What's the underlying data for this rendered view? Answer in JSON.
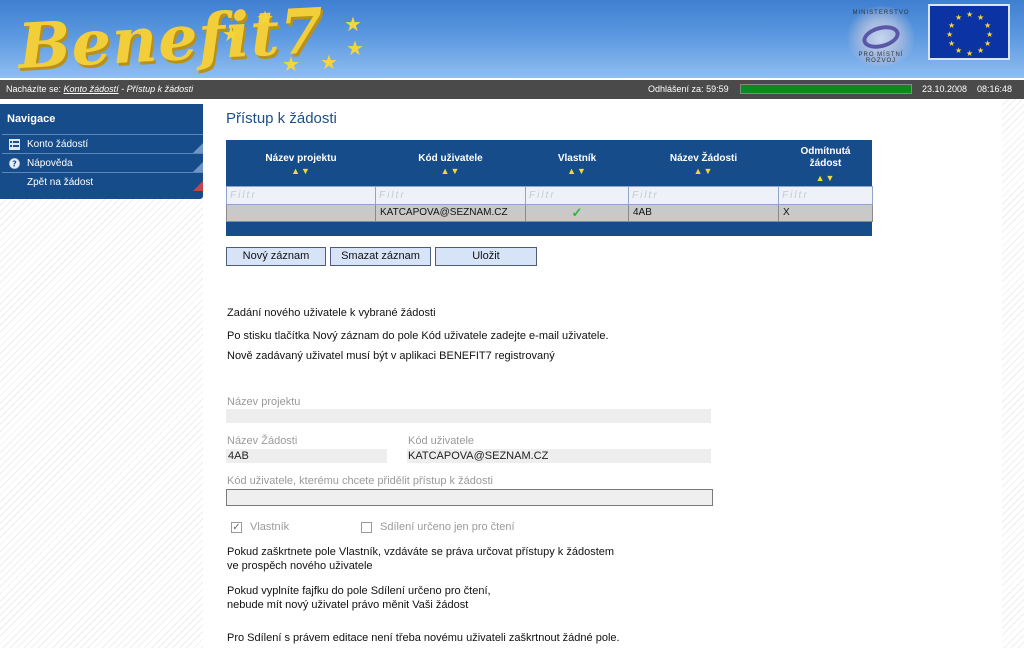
{
  "header": {
    "logo_text": "Benefit7",
    "ministry_text_top": "MINISTERSTVO",
    "ministry_text_bottom": "PRO MÍSTNÍ ROZVOJ"
  },
  "statusbar": {
    "location_label": "Nacházíte se:",
    "breadcrumb_link": "Konto žádostí",
    "breadcrumb_sep": " - ",
    "breadcrumb_current": "Přístup k žádosti",
    "logout_label": "Odhlášení za:",
    "logout_timer": "59:59",
    "session_progress": 1.0,
    "date": "23.10.2008",
    "time": "08:16:48"
  },
  "sidebar": {
    "title": "Navigace",
    "items": [
      {
        "label": "Konto žádostí",
        "icon": "list-icon"
      },
      {
        "label": "Nápověda",
        "icon": "help-icon"
      },
      {
        "label": "Zpět na žádost",
        "icon": ""
      }
    ]
  },
  "main": {
    "title": "Přístup k žádosti",
    "grid": {
      "columns": [
        "Název projektu",
        "Kód uživatele",
        "Vlastník",
        "Název Žádosti",
        "Odmítnutá žádost"
      ],
      "sort_arrows": "▲▼",
      "filter_placeholder": "Filtr",
      "rows": [
        {
          "nazev_projektu": "",
          "kod_uzivatele": "KATCAPOVA@SEZNAM.CZ",
          "vlastnik": "✓",
          "nazev_zadosti": "4AB",
          "odmitnuta": "X"
        }
      ]
    },
    "buttons": {
      "new": "Nový záznam",
      "delete": "Smazat záznam",
      "save": "Uložit"
    },
    "info": {
      "line1": "Zadání nového uživatele k vybrané žádosti",
      "line2": "Po stisku tlačítka Nový záznam do pole Kód uživatele zadejte e-mail uživatele.",
      "line3": "Nově zadávaný uživatel musí být v aplikaci BENEFIT7 registrovaný"
    },
    "form": {
      "nazev_projektu_label": "Název projektu",
      "nazev_projektu_value": "",
      "nazev_zadosti_label": "Název Žádosti",
      "nazev_zadosti_value": "4AB",
      "kod_uzivatele_label": "Kód uživatele",
      "kod_uzivatele_value": "KATCAPOVA@SEZNAM.CZ",
      "share_code_label": "Kód uživatele, kterému chcete přidělit přístup k žádosti",
      "share_code_value": "",
      "vlastnik_label": "Vlastník",
      "vlastnik_checked": true,
      "readonly_label": "Sdílení určeno jen pro čtení",
      "readonly_checked": false
    },
    "notes": {
      "n1a": "Pokud zaškrtnete pole Vlastník, vzdáváte se práva určovat přístupy k žádostem",
      "n1b": "ve prospěch nového uživatele",
      "n2a": "Pokud vyplníte fajfku do pole Sdílení určeno pro čtení,",
      "n2b": "nebude mít nový uživatel právo měnit Vaši žádost",
      "n3": "Pro Sdílení s právem editace není třeba novému uživateli zaškrtnout žádné pole."
    }
  },
  "colors": {
    "nav_blue": "#164c8a",
    "title_blue": "#1d4f8c",
    "progress_green": "#0d8a1f",
    "accent_yellow": "#f2d83a"
  }
}
